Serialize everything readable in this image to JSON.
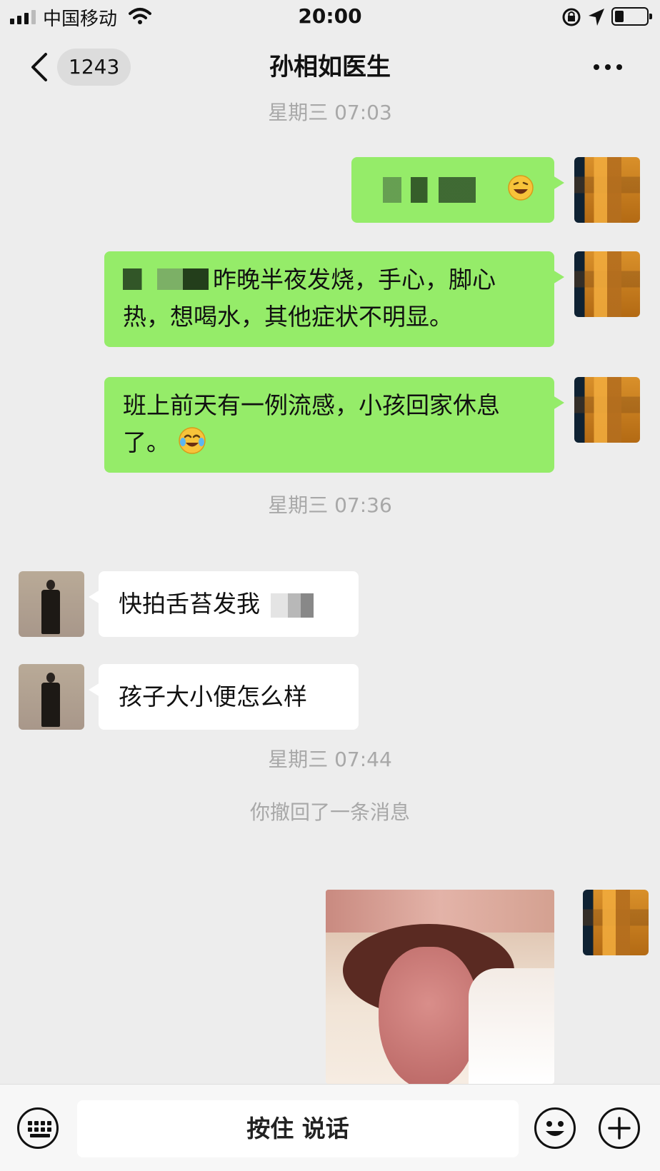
{
  "status_bar": {
    "carrier": "中国移动",
    "time": "20:00"
  },
  "nav": {
    "unread_count": "1243",
    "title": "孙相如医生"
  },
  "messages": {
    "ts1": "星期三 07:03",
    "out2_text": "昨晚半夜发烧，手心，脚心热，想喝水，其他症状不明显。",
    "out3_text": "班上前天有一例流感，小孩回家休息了。",
    "ts2": "星期三 07:36",
    "in1_text": "快拍舌苔发我",
    "in2_text": "孩子大小便怎么样",
    "ts3": "星期三 07:44",
    "recall_notice": "你撤回了一条消息"
  },
  "input_bar": {
    "hold_to_talk": "按住 说话"
  },
  "icons": {
    "keyboard": "keyboard-icon",
    "emoji": "emoji-icon",
    "plus": "plus-icon"
  }
}
